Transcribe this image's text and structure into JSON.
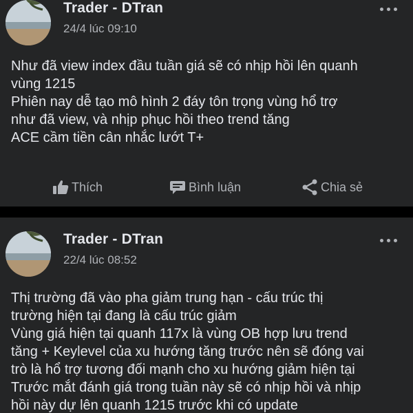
{
  "posts": [
    {
      "author": "Trader - DTran",
      "time": "24/4 lúc 09:10",
      "lines": [
        "Như đã view index đầu tuần giá sẽ có nhịp hồi lên quanh",
        "vùng 1215",
        "Phiên nay dễ tạo mô hình 2 đáy tôn trọng vùng hổ trợ",
        "như đã view, và nhịp phục hồi theo trend tăng",
        "ACE cầm tiền cân nhắc lướt T+"
      ],
      "actions": {
        "like": "Thích",
        "comment": "Bình luận",
        "share": "Chia sẻ"
      }
    },
    {
      "author": "Trader - DTran",
      "time": "22/4 lúc 08:52",
      "lines": [
        "Thị trường đã vào pha giảm trung hạn - cấu trúc thị",
        "trường hiện tại đang là cấu trúc giảm",
        "Vùng giá hiện tại quanh 117x là vùng OB hợp lưu trend",
        "tăng + Keylevel của xu hướng tăng trước nên sẽ đóng vai",
        "trò là hổ trợ tương đối mạnh cho xu hướng giảm hiện tại",
        "Trước mắt đánh giá trong tuần này sẽ có nhịp hồi và nhịp",
        "hồi này dự lên quanh 1215 trước khi có update"
      ]
    }
  ],
  "icons": {
    "more": "more-options-icon",
    "like": "thumbs-up-icon",
    "comment": "comment-icon",
    "share": "share-icon"
  },
  "colors": {
    "background": "#000000",
    "card": "#242526",
    "primary_text": "#e4e6eb",
    "secondary_text": "#b0b3b8"
  }
}
